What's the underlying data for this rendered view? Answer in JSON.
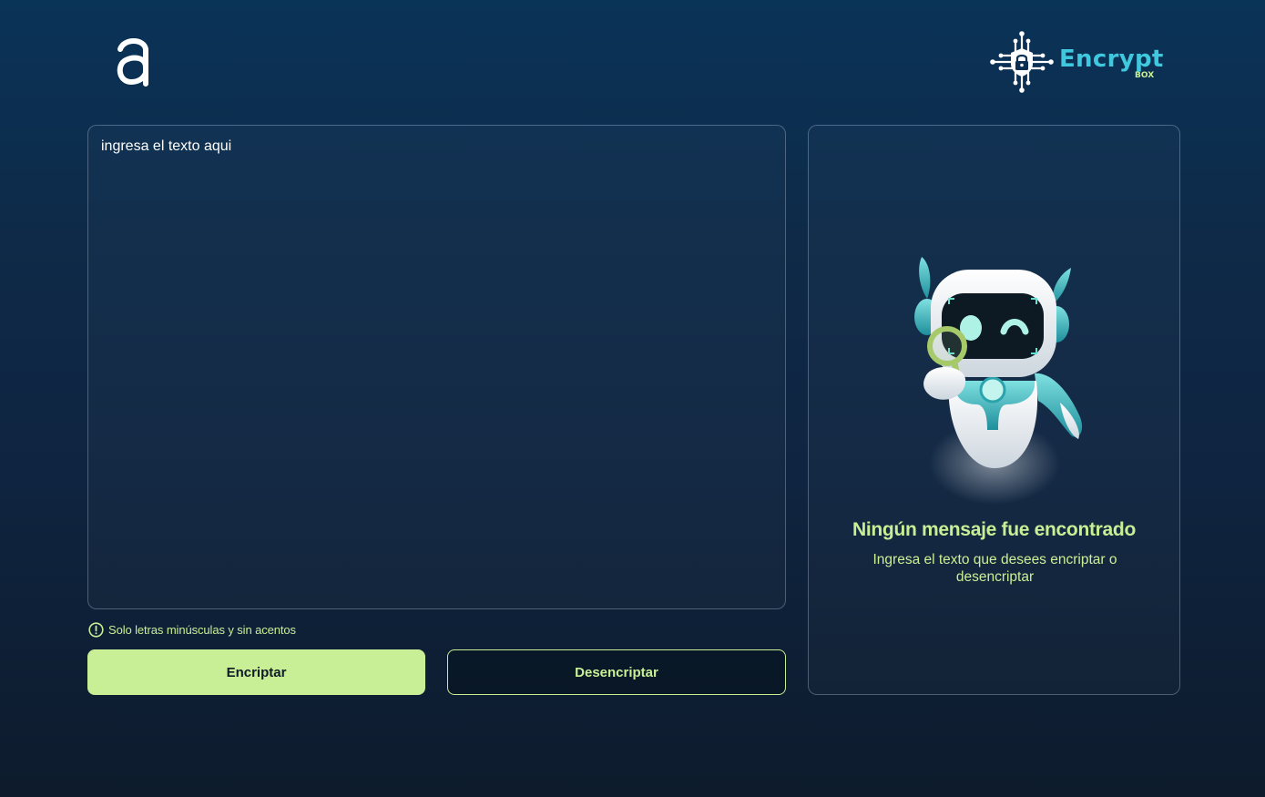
{
  "header": {
    "logo_icon": "alura-a-logo",
    "brand_icon": "circuit-lock-icon",
    "brand_name": "Encrypt",
    "brand_sub": "BOX"
  },
  "editor": {
    "placeholder": "ingresa el texto aqui",
    "value": ""
  },
  "hint": {
    "icon": "exclamation-circle-icon",
    "text": "Solo letras minúsculas y sin acentos"
  },
  "actions": {
    "encrypt_label": "Encriptar",
    "decrypt_label": "Desencriptar"
  },
  "result": {
    "illustration": "robot-magnifier-illustration",
    "title": "Ningún mensaje fue encontrado",
    "description": "Ingresa el texto que desees encriptar o desencriptar"
  },
  "colors": {
    "accent": "#c9ef96",
    "brand": "#3fc8de",
    "background_top": "#0a3358",
    "background_bottom": "#0d1b2c",
    "button_text_dark": "#0f1b27"
  }
}
